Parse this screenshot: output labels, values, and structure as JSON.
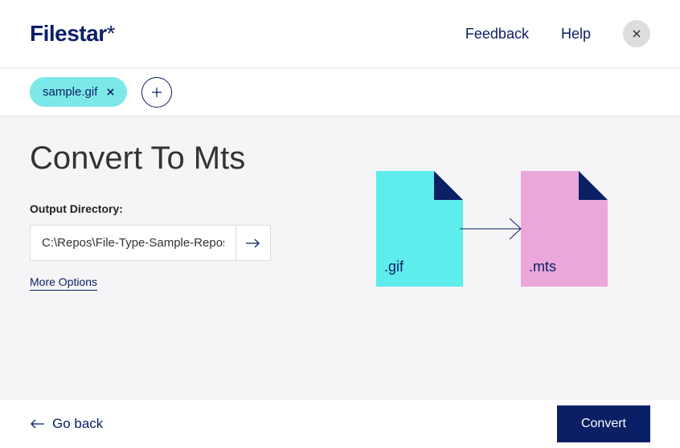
{
  "header": {
    "logo_text": "Filestar",
    "logo_star": "*",
    "feedback_label": "Feedback",
    "help_label": "Help"
  },
  "file_bar": {
    "chip_filename": "sample.gif"
  },
  "main": {
    "title": "Convert To Mts",
    "output_label": "Output Directory:",
    "output_value": "C:\\Repos\\File-Type-Sample-Reposit",
    "more_options_label": "More Options",
    "source_ext": ".gif",
    "target_ext": ".mts"
  },
  "footer": {
    "go_back_label": "Go back",
    "convert_label": "Convert"
  }
}
